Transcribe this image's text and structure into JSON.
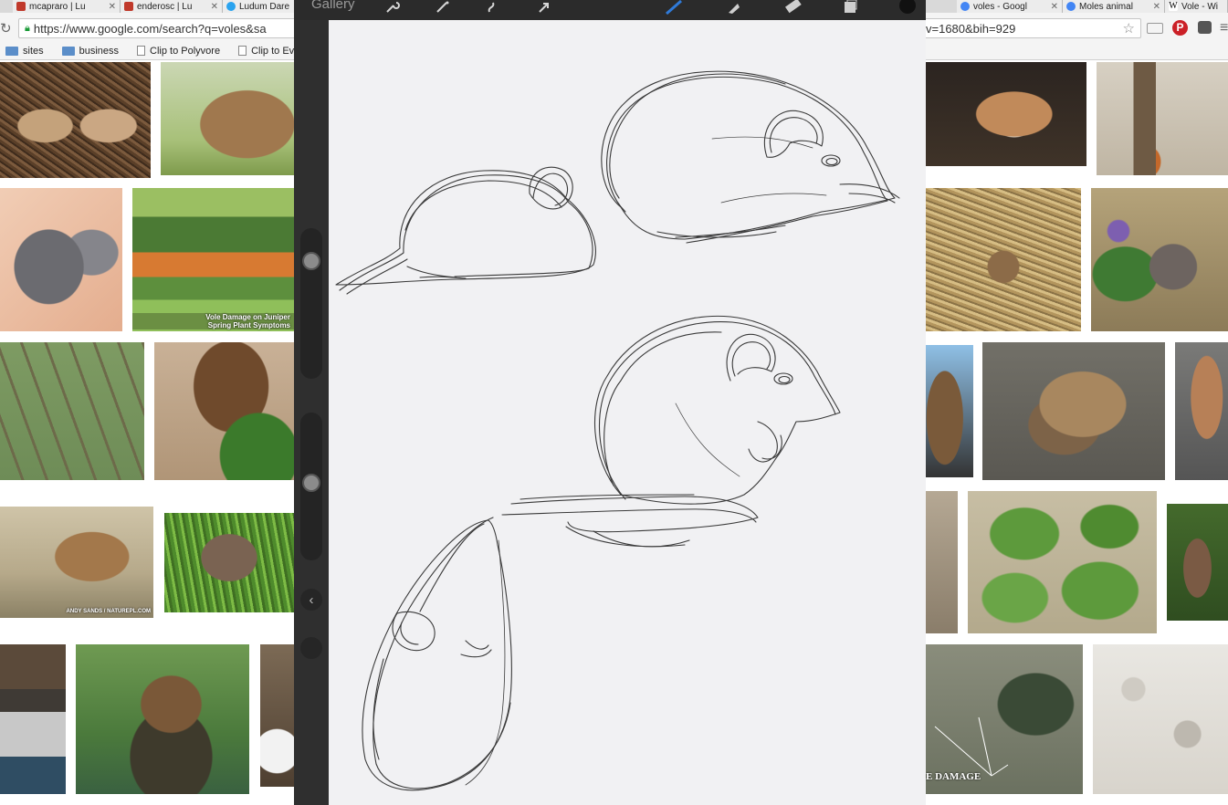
{
  "tabs": [
    {
      "title": "mcapraro | Lu",
      "favicon": "ludum-dare-favicon"
    },
    {
      "title": "enderosc | Lu",
      "favicon": "ludum-dare-favicon"
    },
    {
      "title": "Ludum Dare",
      "favicon": "twitter-bird-icon"
    },
    {
      "title": "voles - Googl",
      "favicon": "google-icon"
    },
    {
      "title": "Moles animal",
      "favicon": "google-icon"
    },
    {
      "title": "Vole - Wi",
      "favicon": "wikipedia-icon"
    }
  ],
  "address": {
    "url_left": "https://www.google.com/search?q=voles&sa",
    "url_right": "v=1680&bih=929"
  },
  "bookmarks": [
    {
      "label": "sites",
      "icon": "folder-icon"
    },
    {
      "label": "business",
      "icon": "folder-icon"
    },
    {
      "label": "Clip to Polyvore",
      "icon": "page-icon"
    },
    {
      "label": "Clip to Eve",
      "icon": "page-icon"
    }
  ],
  "image_captions": {
    "juniper": "Vole Damage on Juniper\nSpring Plant Symptoms",
    "naturepl": "ANDY SANDS / NATUREPL.COM",
    "damage": "E DAMAGE"
  },
  "procreate": {
    "gallery_label": "Gallery",
    "top_tools": [
      "wrench-icon",
      "magic-wand-icon",
      "selection-icon",
      "transform-arrow-icon",
      "brush-icon",
      "smudge-icon",
      "eraser-icon",
      "layers-icon",
      "color-swatch-icon"
    ],
    "side_buttons": [
      "undo-icon",
      "redo-icon"
    ]
  },
  "colors": {
    "procreate_dark": "#2b2b2b",
    "canvas": "#f1f1f3",
    "brush_active": "#2f7ad8"
  }
}
